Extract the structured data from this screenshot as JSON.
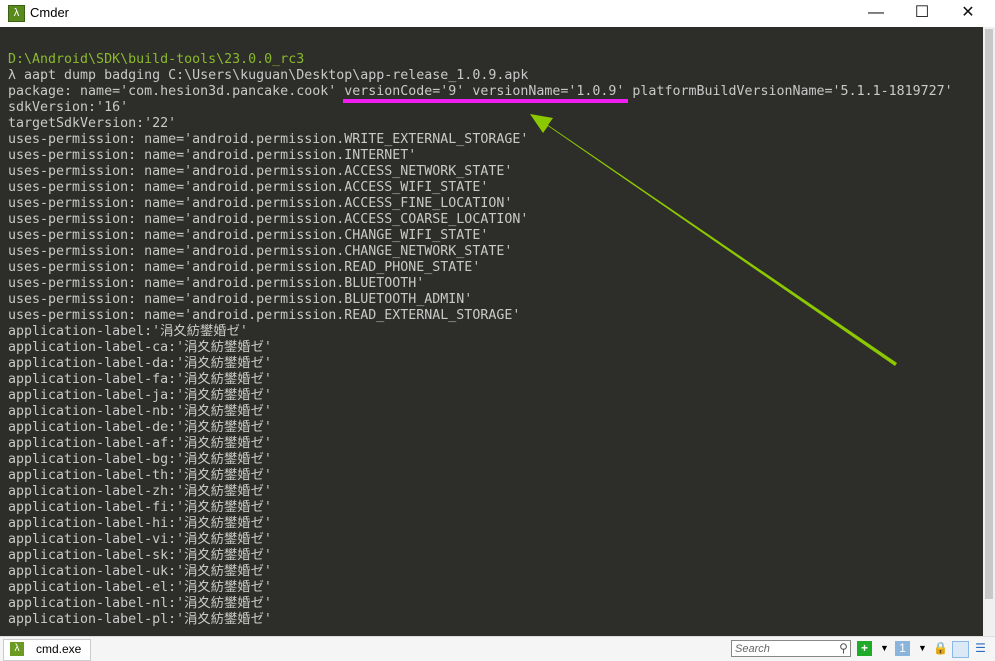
{
  "window": {
    "title": "Cmder",
    "minimize": "—",
    "maximize": "☐",
    "close": "✕"
  },
  "terminal": {
    "lines": [
      {
        "text": "D:\\Android\\SDK\\build-tools\\23.0.0_rc3",
        "color": "green"
      },
      {
        "text": "λ aapt dump badging C:\\Users\\kuguan\\Desktop\\app-release_1.0.9.apk"
      },
      {
        "text": "package: name='com.hesion3d.pancake.cook' versionCode='9' versionName='1.0.9' platformBuildVersionName='5.1.1-1819727'"
      },
      {
        "text": "sdkVersion:'16'"
      },
      {
        "text": "targetSdkVersion:'22'"
      },
      {
        "text": "uses-permission: name='android.permission.WRITE_EXTERNAL_STORAGE'"
      },
      {
        "text": "uses-permission: name='android.permission.INTERNET'"
      },
      {
        "text": "uses-permission: name='android.permission.ACCESS_NETWORK_STATE'"
      },
      {
        "text": "uses-permission: name='android.permission.ACCESS_WIFI_STATE'"
      },
      {
        "text": "uses-permission: name='android.permission.ACCESS_FINE_LOCATION'"
      },
      {
        "text": "uses-permission: name='android.permission.ACCESS_COARSE_LOCATION'"
      },
      {
        "text": "uses-permission: name='android.permission.CHANGE_WIFI_STATE'"
      },
      {
        "text": "uses-permission: name='android.permission.CHANGE_NETWORK_STATE'"
      },
      {
        "text": "uses-permission: name='android.permission.READ_PHONE_STATE'"
      },
      {
        "text": "uses-permission: name='android.permission.BLUETOOTH'"
      },
      {
        "text": "uses-permission: name='android.permission.BLUETOOTH_ADMIN'"
      },
      {
        "text": "uses-permission: name='android.permission.READ_EXTERNAL_STORAGE'"
      },
      {
        "text": "application-label:'涓夊紡鐢婚ゼ'"
      },
      {
        "text": "application-label-ca:'涓夊紡鐢婚ゼ'"
      },
      {
        "text": "application-label-da:'涓夊紡鐢婚ゼ'"
      },
      {
        "text": "application-label-fa:'涓夊紡鐢婚ゼ'"
      },
      {
        "text": "application-label-ja:'涓夊紡鐢婚ゼ'"
      },
      {
        "text": "application-label-nb:'涓夊紡鐢婚ゼ'"
      },
      {
        "text": "application-label-de:'涓夊紡鐢婚ゼ'"
      },
      {
        "text": "application-label-af:'涓夊紡鐢婚ゼ'"
      },
      {
        "text": "application-label-bg:'涓夊紡鐢婚ゼ'"
      },
      {
        "text": "application-label-th:'涓夊紡鐢婚ゼ'"
      },
      {
        "text": "application-label-zh:'涓夊紡鐢婚ゼ'"
      },
      {
        "text": "application-label-fi:'涓夊紡鐢婚ゼ'"
      },
      {
        "text": "application-label-hi:'涓夊紡鐢婚ゼ'"
      },
      {
        "text": "application-label-vi:'涓夊紡鐢婚ゼ'"
      },
      {
        "text": "application-label-sk:'涓夊紡鐢婚ゼ'"
      },
      {
        "text": "application-label-uk:'涓夊紡鐢婚ゼ'"
      },
      {
        "text": "application-label-el:'涓夊紡鐢婚ゼ'"
      },
      {
        "text": "application-label-nl:'涓夊紡鐢婚ゼ'"
      },
      {
        "text": "application-label-pl:'涓夊紡鐢婚ゼ'"
      }
    ]
  },
  "annotations": {
    "underline_color": "#f01ef0",
    "arrow_color": "#8cc800"
  },
  "tabbar": {
    "tab_label": "cmd.exe",
    "search_placeholder": "Search"
  }
}
